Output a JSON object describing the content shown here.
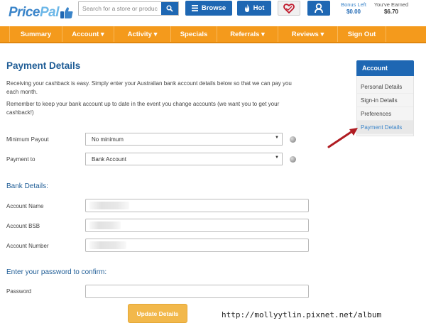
{
  "header": {
    "logo": {
      "part1": "Price",
      "part2": "Pal"
    },
    "search": {
      "placeholder": "Search for a store or product"
    },
    "browse_label": "Browse",
    "hot_label": "Hot",
    "bonus": {
      "label": "Bonus Left",
      "value": "$0.00"
    },
    "earned": {
      "label": "You've Earned",
      "value": "$6.70"
    }
  },
  "nav": {
    "items": [
      {
        "label": "Summary"
      },
      {
        "label": "Account ▾"
      },
      {
        "label": "Activity ▾"
      },
      {
        "label": "Specials"
      },
      {
        "label": "Referrals ▾"
      },
      {
        "label": "Reviews ▾"
      },
      {
        "label": "Sign Out"
      }
    ]
  },
  "main": {
    "title": "Payment Details",
    "intro": "Receiving your cashback is easy. Simply enter your Australian bank account details below so that we can pay you each month.",
    "reminder": "Remember to keep your bank account up to date in the event you change accounts (we want you to get your cashback!)",
    "minimum_payout": {
      "label": "Minimum Payout",
      "value": "No minimum"
    },
    "payment_to": {
      "label": "Payment to",
      "value": "Bank Account"
    },
    "bank_section_title": "Bank Details:",
    "account_name_label": "Account Name",
    "account_bsb_label": "Account BSB",
    "account_number_label": "Account Number",
    "confirm_section_title": "Enter your password to confirm:",
    "password_label": "Password",
    "update_button": "Update Details"
  },
  "sidebar": {
    "title": "Account",
    "items": [
      {
        "label": "Personal Details",
        "active": false
      },
      {
        "label": "Sign-in Details",
        "active": false
      },
      {
        "label": "Preferences",
        "active": false
      },
      {
        "label": "Payment Details",
        "active": true
      }
    ]
  },
  "watermark": "http://mollyytlin.pixnet.net/album",
  "colors": {
    "brand_blue": "#1e67b3",
    "nav_orange": "#f49a1c",
    "title_blue": "#1f5d96",
    "annotation_red": "#b01c22"
  },
  "icons": [
    "search-icon",
    "list-icon",
    "flame-icon",
    "heart-icon",
    "user-icon",
    "help-icon",
    "thumbs-up-icon"
  ]
}
